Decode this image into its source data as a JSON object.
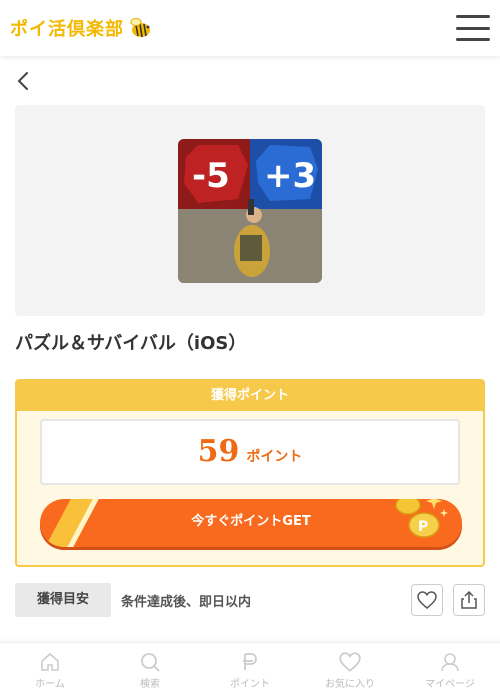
{
  "header": {
    "logo_text": "ポイ活倶楽部",
    "menu_icon": "hamburger-icon"
  },
  "nav": {
    "back_icon": "chevron-left-icon"
  },
  "offer": {
    "title": "パズル＆サバイバル（iOS）",
    "thumbnail": {
      "left_value": "-5",
      "right_value": "+3"
    }
  },
  "points": {
    "heading": "獲得ポイント",
    "value": "59",
    "unit": "ポイント",
    "cta_label": "今すぐポイントGET"
  },
  "estimate": {
    "tag": "獲得目安",
    "text": "条件達成後、即日以内"
  },
  "tabbar": {
    "items": [
      {
        "label": "ホーム",
        "icon": "home-icon"
      },
      {
        "label": "検索",
        "icon": "search-icon"
      },
      {
        "label": "ポイント",
        "icon": "point-icon"
      },
      {
        "label": "お気に入り",
        "icon": "heart-icon"
      },
      {
        "label": "マイページ",
        "icon": "user-icon"
      }
    ]
  },
  "colors": {
    "accent": "#fa6a1e",
    "gold": "#f7c94a",
    "logo": "#f5b800"
  }
}
